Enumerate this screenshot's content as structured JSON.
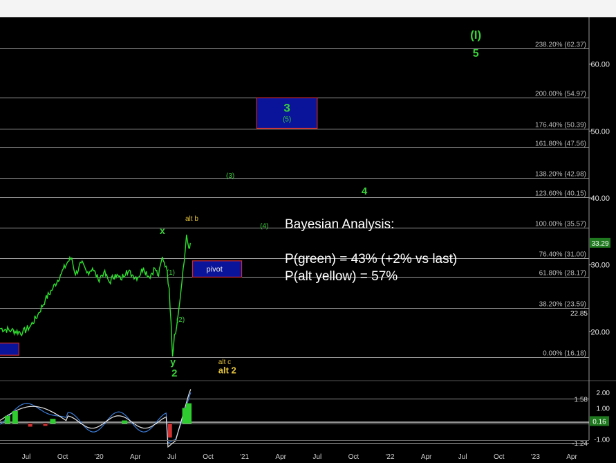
{
  "chart_data": {
    "type": "line",
    "x_ticks": [
      "Jul",
      "Oct",
      "'20",
      "Apr",
      "Jul",
      "Oct",
      "'21",
      "Apr",
      "Jul",
      "Oct",
      "'22",
      "Apr",
      "Jul",
      "Oct",
      "'23",
      "Apr"
    ],
    "price_axis": {
      "ticks": [
        "20.00",
        "30.00",
        "40.00",
        "50.00",
        "60.00"
      ],
      "last_price": "33.29",
      "last_price_value": 33.29
    },
    "fib_levels": [
      {
        "label": "238.20% (62.37)",
        "value": 62.37
      },
      {
        "label": "200.00% (54.97)",
        "value": 54.97
      },
      {
        "label": "176.40% (50.39)",
        "value": 50.39
      },
      {
        "label": "161.80% (47.56)",
        "value": 47.56
      },
      {
        "label": "138.20% (42.98)",
        "value": 42.98
      },
      {
        "label": "123.60% (40.15)",
        "value": 40.15
      },
      {
        "label": "100.00% (35.57)",
        "value": 35.57
      },
      {
        "label": "76.40% (31.00)",
        "value": 31.0
      },
      {
        "label": "61.80% (28.17)",
        "value": 28.17
      },
      {
        "label": "38.20% (23.59)",
        "value": 23.59
      },
      {
        "label": "0.00% (16.18)",
        "value": 16.18
      }
    ],
    "extra_right_label": {
      "label": "22.85",
      "value": 22.85
    },
    "price_series": [
      {
        "x": 0,
        "y": 20.5
      },
      {
        "x": 3,
        "y": 20.2
      },
      {
        "x": 6,
        "y": 19.9
      },
      {
        "x": 8,
        "y": 20.8
      },
      {
        "x": 10,
        "y": 22.5
      },
      {
        "x": 12,
        "y": 24.8
      },
      {
        "x": 14,
        "y": 26.5
      },
      {
        "x": 16,
        "y": 28.5
      },
      {
        "x": 18,
        "y": 30.5
      },
      {
        "x": 19,
        "y": 31.0
      },
      {
        "x": 20,
        "y": 28.5
      },
      {
        "x": 21.5,
        "y": 30.3
      },
      {
        "x": 23,
        "y": 28.8
      },
      {
        "x": 24.5,
        "y": 29.5
      },
      {
        "x": 26,
        "y": 27.8
      },
      {
        "x": 27.5,
        "y": 28.9
      },
      {
        "x": 29,
        "y": 27.4
      },
      {
        "x": 30.5,
        "y": 28.6
      },
      {
        "x": 32,
        "y": 27.8
      },
      {
        "x": 33.5,
        "y": 29.2
      },
      {
        "x": 35,
        "y": 28.5
      },
      {
        "x": 36.5,
        "y": 28.1
      },
      {
        "x": 38,
        "y": 29.6
      },
      {
        "x": 39.5,
        "y": 28.2
      },
      {
        "x": 41,
        "y": 29.5
      },
      {
        "x": 42,
        "y": 28.3
      },
      {
        "x": 43,
        "y": 31.2
      },
      {
        "x": 44,
        "y": 29.8
      },
      {
        "x": 44.8,
        "y": 26.5
      },
      {
        "x": 45.3,
        "y": 21.5
      },
      {
        "x": 45.7,
        "y": 16.3
      },
      {
        "x": 46.2,
        "y": 19.6
      },
      {
        "x": 46.8,
        "y": 20.8
      },
      {
        "x": 47.5,
        "y": 24.0
      },
      {
        "x": 48.2,
        "y": 27.5
      },
      {
        "x": 48.8,
        "y": 30.5
      },
      {
        "x": 49.4,
        "y": 34.5
      },
      {
        "x": 50.0,
        "y": 32.5
      },
      {
        "x": 50.4,
        "y": 33.29
      }
    ],
    "indicator": {
      "ticks": [
        "2.00",
        "1.00",
        "-1.00"
      ],
      "levels": [
        1.58,
        0.14,
        0.09,
        0.0,
        -1.24
      ],
      "value_label": "0.16"
    },
    "blue_boxes": [
      {
        "label": "3",
        "sublabel": "(5)",
        "x0": 68,
        "x1": 84,
        "y0": 50.4,
        "y1": 54.97
      },
      {
        "label": "pivot",
        "x0": 51,
        "x1": 64,
        "y0": 28.17,
        "y1": 30.6
      },
      {
        "label": "",
        "x0": -3,
        "x1": 5,
        "y0": 16.5,
        "y1": 18.3
      }
    ],
    "wave_labels": [
      {
        "text": "(I)",
        "color": "#3bd13b",
        "x": 126,
        "y": 63.8,
        "size": 17
      },
      {
        "text": "5",
        "color": "#3bd13b",
        "x": 126,
        "y": 61.1,
        "size": 16
      },
      {
        "text": "(3)",
        "color": "#3bd13b",
        "x": 61,
        "y": 43.0,
        "size": 10
      },
      {
        "text": "4",
        "color": "#3bd13b",
        "x": 96.5,
        "y": 40.5,
        "size": 15
      },
      {
        "text": "(4)",
        "color": "#3bd13b",
        "x": 70,
        "y": 35.5,
        "size": 10
      },
      {
        "text": "x",
        "color": "#3bd13b",
        "x": 43,
        "y": 34.6,
        "size": 14
      },
      {
        "text": "alt b",
        "color": "#e2c23a",
        "x": 50.8,
        "y": 36.6,
        "size": 10
      },
      {
        "text": "(1)",
        "color": "#3bd13b",
        "x": 45.2,
        "y": 28.5,
        "size": 10
      },
      {
        "text": "(2)",
        "color": "#3bd13b",
        "x": 47.8,
        "y": 21.5,
        "size": 10
      },
      {
        "text": "y",
        "color": "#3bd13b",
        "x": 45.8,
        "y": 15.0,
        "size": 14
      },
      {
        "text": "2",
        "color": "#3bd13b",
        "x": 46.2,
        "y": 13.3,
        "size": 15
      },
      {
        "text": "alt c",
        "color": "#e2c23a",
        "x": 59.5,
        "y": 15.2,
        "size": 10
      },
      {
        "text": "alt 2",
        "color": "#e2c23a",
        "x": 60.2,
        "y": 13.8,
        "size": 13
      }
    ],
    "xlim": [
      0,
      156
    ],
    "ylim": [
      12.9,
      67
    ],
    "grid": true
  },
  "annotation": {
    "heading": "Bayesian Analysis:",
    "line1": "P(green) = 43% (+2% vs last)",
    "line2": "P(alt yellow) = 57%"
  },
  "colors": {
    "background": "#000000",
    "price_line": "#2ee02e",
    "fib_line": "#cfcfcf",
    "box_fill": "#0a149a",
    "box_border": "#d02a2a",
    "green_label": "#3bd13b",
    "yellow_label": "#e2c23a",
    "last_price_bg": "#1f7a1f"
  }
}
